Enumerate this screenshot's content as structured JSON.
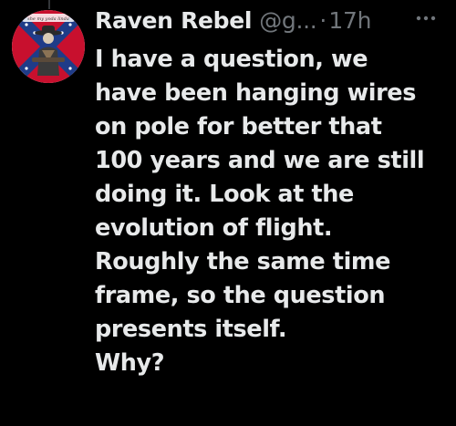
{
  "tweet": {
    "author": {
      "display_name": "Raven Rebel",
      "handle": "@g...",
      "avatar_icon": "rebel-flag-cowboy-avatar-icon",
      "avatar_caption": "she my yoda linda"
    },
    "separator": "·",
    "timestamp": "17h",
    "more_icon": "more-dots-icon",
    "text_lines": [
      "I have a question, we",
      "have been hanging wires",
      "on pole for better that",
      "100 years and we are still",
      "doing it. Look at the",
      "evolution of flight.",
      "Roughly the same time",
      "frame, so the question",
      "presents itself.",
      "Why?"
    ]
  },
  "colors": {
    "background": "#000000",
    "primary_text": "#e7e9ea",
    "secondary_text": "#71767b",
    "flag_red": "#c8102e",
    "flag_blue": "#1f3c88"
  }
}
